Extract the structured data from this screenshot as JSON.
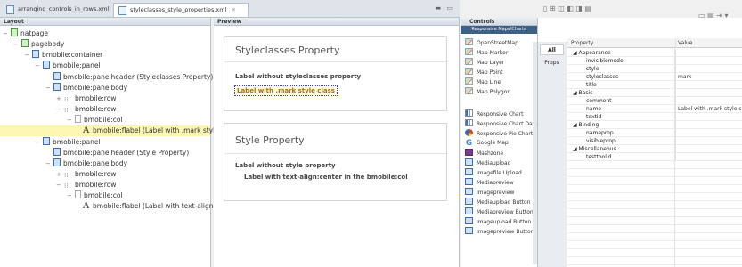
{
  "editor_tabs": [
    {
      "label": "arranging_controls_in_rows.xml"
    },
    {
      "label": "styleclasses_style_properties.xml",
      "close": "✕"
    }
  ],
  "layout": {
    "header": "Layout",
    "tree": [
      {
        "label": "natpage",
        "toggle": "−"
      },
      {
        "label": "pagebody",
        "toggle": "−"
      },
      {
        "label": "bmobile:container",
        "toggle": "−"
      },
      {
        "label": "bmobile:panel",
        "toggle": "−"
      },
      {
        "label": "bmobile:panelheader (Styleclasses Property)",
        "toggle": ""
      },
      {
        "label": "bmobile:panelbody",
        "toggle": "−"
      },
      {
        "label": "bmobile:row",
        "toggle": "+"
      },
      {
        "label": "bmobile:row",
        "toggle": "−"
      },
      {
        "label": "bmobile:col",
        "toggle": "−"
      },
      {
        "label": "bmobile:flabel (Label with .mark style class)",
        "toggle": ""
      },
      {
        "label": "bmobile:panel",
        "toggle": "−"
      },
      {
        "label": "bmobile:panelheader (Style Property)",
        "toggle": ""
      },
      {
        "label": "bmobile:panelbody",
        "toggle": "−"
      },
      {
        "label": "bmobile:row",
        "toggle": "+"
      },
      {
        "label": "bmobile:row",
        "toggle": "−"
      },
      {
        "label": "bmobile:col",
        "toggle": "−"
      },
      {
        "label": "bmobile:flabel (Label with text-align:center in the bmobile:col)",
        "toggle": ""
      }
    ]
  },
  "preview": {
    "header": "Preview",
    "card1": {
      "title": "Styleclasses Property",
      "label1": "Label without styleclasses property",
      "label2": "Label with .mark style class"
    },
    "card2": {
      "title": "Style Property",
      "label1": "Label without style property",
      "label2": "Label with text-align:center in the bmobile:col"
    }
  },
  "controls": {
    "header": "Controls",
    "subheader": "Responsive Maps/Charts",
    "items": [
      {
        "label": "OpenStreetMap",
        "icon": "map-icon"
      },
      {
        "label": "Map Marker",
        "icon": "map-icon"
      },
      {
        "label": "Map Layer",
        "icon": "map-icon"
      },
      {
        "label": "Map Point",
        "icon": "map-icon"
      },
      {
        "label": "Map Line",
        "icon": "map-icon"
      },
      {
        "label": "Map Polygon",
        "icon": "map-icon"
      },
      {
        "label": "Responsive Chart",
        "icon": "chart-icon"
      },
      {
        "label": "Responsive Chart Data",
        "icon": "chart-icon"
      },
      {
        "label": "Responsive Pie Chart",
        "icon": "pie-chart-icon"
      },
      {
        "label": "Google Map",
        "icon": "google-icon"
      },
      {
        "label": "Mashzone",
        "icon": "mashzone-icon"
      },
      {
        "label": "Mediaupload",
        "icon": "control-icon"
      },
      {
        "label": "Imagefile Upload",
        "icon": "control-icon"
      },
      {
        "label": "Mediapreview",
        "icon": "control-icon"
      },
      {
        "label": "Imagepreview",
        "icon": "control-icon"
      },
      {
        "label": "Mediaupload Button",
        "icon": "control-icon"
      },
      {
        "label": "Mediapreview Button",
        "icon": "control-icon"
      },
      {
        "label": "Imageupload Button",
        "icon": "control-icon"
      },
      {
        "label": "Imagepreview Button",
        "icon": "control-icon"
      }
    ]
  },
  "properties": {
    "tabs": [
      {
        "label": "All"
      },
      {
        "label": "Props"
      }
    ],
    "col_property": "Property",
    "col_value": "Value",
    "rows": [
      {
        "key": "◢ Appearance",
        "value": ""
      },
      {
        "key": "invisiblemode",
        "value": ""
      },
      {
        "key": "style",
        "value": ""
      },
      {
        "key": "styleclasses",
        "value": "mark"
      },
      {
        "key": "title",
        "value": ""
      },
      {
        "key": "◢ Basic",
        "value": ""
      },
      {
        "key": "comment",
        "value": ""
      },
      {
        "key": "name",
        "value": "Label with .mark style class"
      },
      {
        "key": "textid",
        "value": ""
      },
      {
        "key": "◢ Binding",
        "value": ""
      },
      {
        "key": "nameprop",
        "value": ""
      },
      {
        "key": "visibleprop",
        "value": ""
      },
      {
        "key": "◢ Miscellaneous",
        "value": ""
      },
      {
        "key": "testtoolid",
        "value": ""
      }
    ]
  },
  "colors": {
    "accent": "#3e5f86",
    "selection": "#fdf6b2",
    "mark_text": "#a8700a"
  }
}
